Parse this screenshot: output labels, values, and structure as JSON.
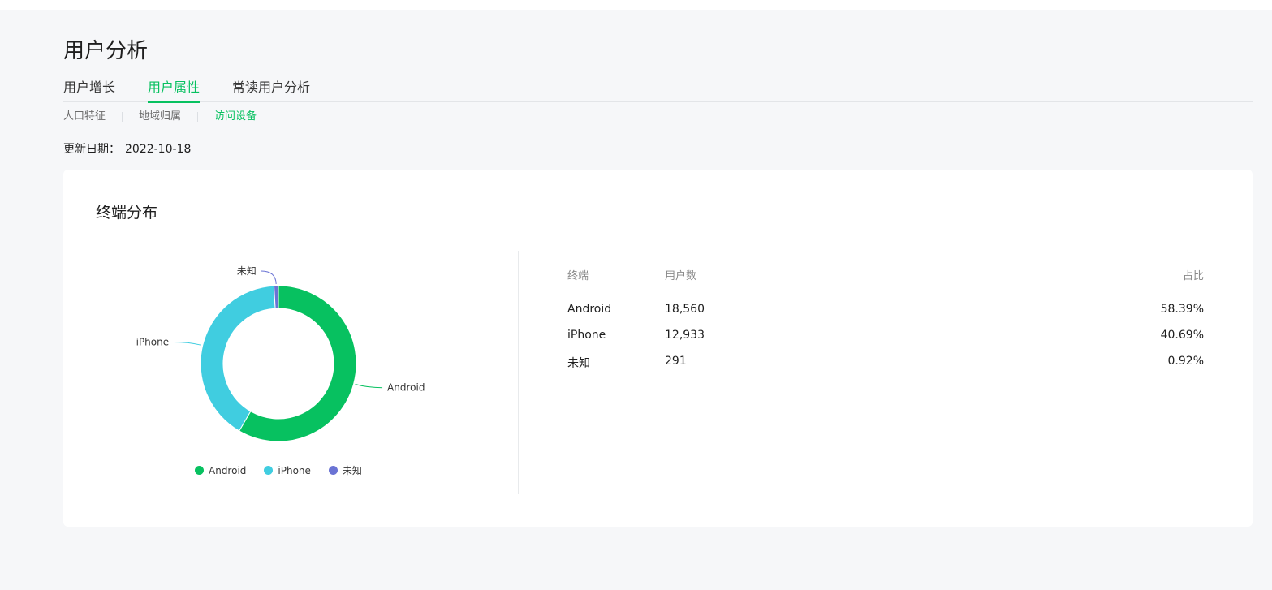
{
  "page": {
    "title": "用户分析",
    "tabs": [
      {
        "label": "用户增长",
        "active": false
      },
      {
        "label": "用户属性",
        "active": true
      },
      {
        "label": "常读用户分析",
        "active": false
      }
    ],
    "subtabs": [
      {
        "label": "人口特征",
        "active": false
      },
      {
        "label": "地域归属",
        "active": false
      },
      {
        "label": "访问设备",
        "active": true
      }
    ],
    "update_label": "更新日期：",
    "update_date": "2022-10-18"
  },
  "card": {
    "title": "终端分布",
    "table": {
      "headers": [
        "终端",
        "用户数",
        "占比"
      ],
      "rows": [
        {
          "device": "Android",
          "users": "18,560",
          "share": "58.39%"
        },
        {
          "device": "iPhone",
          "users": "12,933",
          "share": "40.69%"
        },
        {
          "device": "未知",
          "users": "291",
          "share": "0.92%"
        }
      ]
    }
  },
  "chart_data": {
    "type": "pie",
    "categories": [
      "Android",
      "iPhone",
      "未知"
    ],
    "values": [
      18560,
      12933,
      291
    ],
    "colors": [
      "#07c160",
      "#40cde0",
      "#6a73d4"
    ],
    "donut": true,
    "legend": "bottom"
  }
}
